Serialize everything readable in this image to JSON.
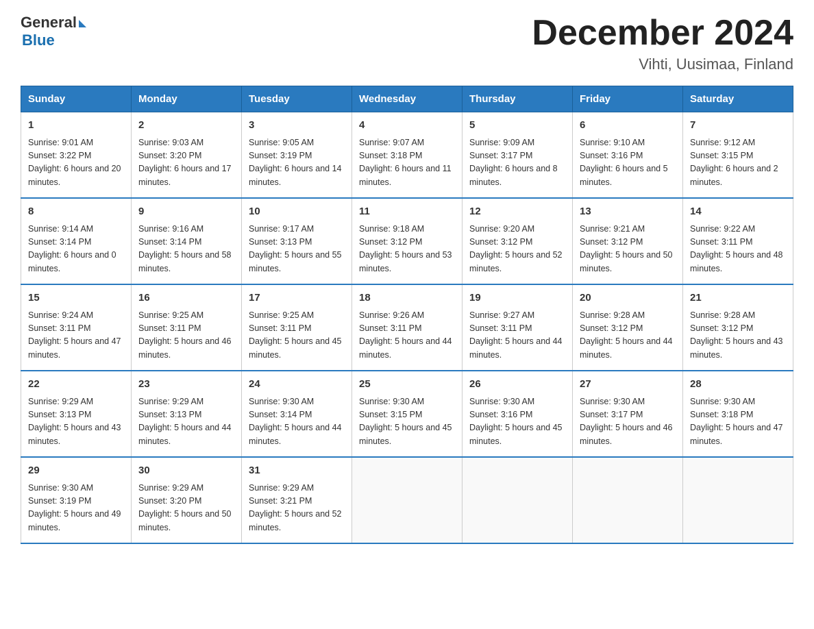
{
  "header": {
    "logo": {
      "general": "General",
      "blue": "Blue"
    },
    "month_title": "December 2024",
    "location": "Vihti, Uusimaa, Finland"
  },
  "days_of_week": [
    "Sunday",
    "Monday",
    "Tuesday",
    "Wednesday",
    "Thursday",
    "Friday",
    "Saturday"
  ],
  "weeks": [
    [
      {
        "day": "1",
        "sunrise": "9:01 AM",
        "sunset": "3:22 PM",
        "daylight": "6 hours and 20 minutes"
      },
      {
        "day": "2",
        "sunrise": "9:03 AM",
        "sunset": "3:20 PM",
        "daylight": "6 hours and 17 minutes"
      },
      {
        "day": "3",
        "sunrise": "9:05 AM",
        "sunset": "3:19 PM",
        "daylight": "6 hours and 14 minutes"
      },
      {
        "day": "4",
        "sunrise": "9:07 AM",
        "sunset": "3:18 PM",
        "daylight": "6 hours and 11 minutes"
      },
      {
        "day": "5",
        "sunrise": "9:09 AM",
        "sunset": "3:17 PM",
        "daylight": "6 hours and 8 minutes"
      },
      {
        "day": "6",
        "sunrise": "9:10 AM",
        "sunset": "3:16 PM",
        "daylight": "6 hours and 5 minutes"
      },
      {
        "day": "7",
        "sunrise": "9:12 AM",
        "sunset": "3:15 PM",
        "daylight": "6 hours and 2 minutes"
      }
    ],
    [
      {
        "day": "8",
        "sunrise": "9:14 AM",
        "sunset": "3:14 PM",
        "daylight": "6 hours and 0 minutes"
      },
      {
        "day": "9",
        "sunrise": "9:16 AM",
        "sunset": "3:14 PM",
        "daylight": "5 hours and 58 minutes"
      },
      {
        "day": "10",
        "sunrise": "9:17 AM",
        "sunset": "3:13 PM",
        "daylight": "5 hours and 55 minutes"
      },
      {
        "day": "11",
        "sunrise": "9:18 AM",
        "sunset": "3:12 PM",
        "daylight": "5 hours and 53 minutes"
      },
      {
        "day": "12",
        "sunrise": "9:20 AM",
        "sunset": "3:12 PM",
        "daylight": "5 hours and 52 minutes"
      },
      {
        "day": "13",
        "sunrise": "9:21 AM",
        "sunset": "3:12 PM",
        "daylight": "5 hours and 50 minutes"
      },
      {
        "day": "14",
        "sunrise": "9:22 AM",
        "sunset": "3:11 PM",
        "daylight": "5 hours and 48 minutes"
      }
    ],
    [
      {
        "day": "15",
        "sunrise": "9:24 AM",
        "sunset": "3:11 PM",
        "daylight": "5 hours and 47 minutes"
      },
      {
        "day": "16",
        "sunrise": "9:25 AM",
        "sunset": "3:11 PM",
        "daylight": "5 hours and 46 minutes"
      },
      {
        "day": "17",
        "sunrise": "9:25 AM",
        "sunset": "3:11 PM",
        "daylight": "5 hours and 45 minutes"
      },
      {
        "day": "18",
        "sunrise": "9:26 AM",
        "sunset": "3:11 PM",
        "daylight": "5 hours and 44 minutes"
      },
      {
        "day": "19",
        "sunrise": "9:27 AM",
        "sunset": "3:11 PM",
        "daylight": "5 hours and 44 minutes"
      },
      {
        "day": "20",
        "sunrise": "9:28 AM",
        "sunset": "3:12 PM",
        "daylight": "5 hours and 44 minutes"
      },
      {
        "day": "21",
        "sunrise": "9:28 AM",
        "sunset": "3:12 PM",
        "daylight": "5 hours and 43 minutes"
      }
    ],
    [
      {
        "day": "22",
        "sunrise": "9:29 AM",
        "sunset": "3:13 PM",
        "daylight": "5 hours and 43 minutes"
      },
      {
        "day": "23",
        "sunrise": "9:29 AM",
        "sunset": "3:13 PM",
        "daylight": "5 hours and 44 minutes"
      },
      {
        "day": "24",
        "sunrise": "9:30 AM",
        "sunset": "3:14 PM",
        "daylight": "5 hours and 44 minutes"
      },
      {
        "day": "25",
        "sunrise": "9:30 AM",
        "sunset": "3:15 PM",
        "daylight": "5 hours and 45 minutes"
      },
      {
        "day": "26",
        "sunrise": "9:30 AM",
        "sunset": "3:16 PM",
        "daylight": "5 hours and 45 minutes"
      },
      {
        "day": "27",
        "sunrise": "9:30 AM",
        "sunset": "3:17 PM",
        "daylight": "5 hours and 46 minutes"
      },
      {
        "day": "28",
        "sunrise": "9:30 AM",
        "sunset": "3:18 PM",
        "daylight": "5 hours and 47 minutes"
      }
    ],
    [
      {
        "day": "29",
        "sunrise": "9:30 AM",
        "sunset": "3:19 PM",
        "daylight": "5 hours and 49 minutes"
      },
      {
        "day": "30",
        "sunrise": "9:29 AM",
        "sunset": "3:20 PM",
        "daylight": "5 hours and 50 minutes"
      },
      {
        "day": "31",
        "sunrise": "9:29 AM",
        "sunset": "3:21 PM",
        "daylight": "5 hours and 52 minutes"
      },
      null,
      null,
      null,
      null
    ]
  ],
  "labels": {
    "sunrise": "Sunrise:",
    "sunset": "Sunset:",
    "daylight": "Daylight:"
  }
}
